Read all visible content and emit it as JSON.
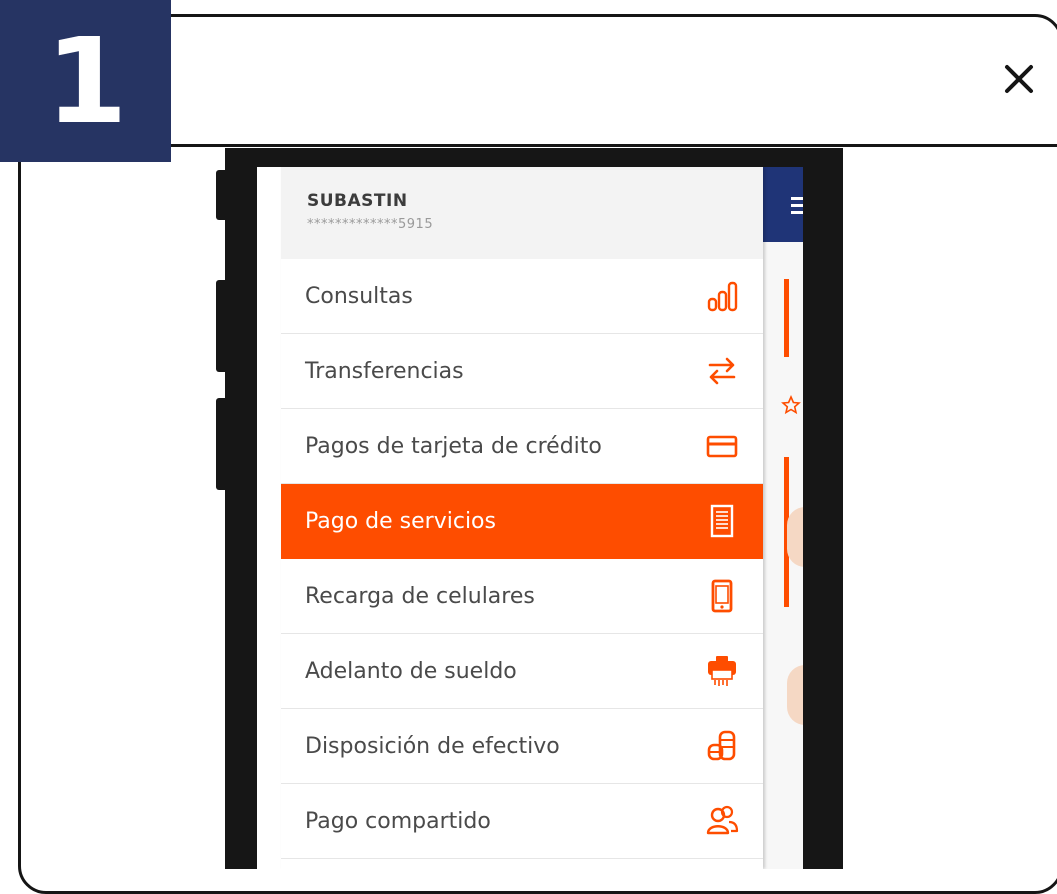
{
  "step": {
    "number": "1"
  },
  "colors": {
    "badge": "#263463",
    "accent": "#fe4d00",
    "app_nav": "#1f3477",
    "frame": "#151515"
  },
  "close_icon": "close-icon",
  "phone": {
    "user": {
      "name": "SUBASTIN",
      "account": "*************5915"
    },
    "menu_items": [
      {
        "label": "Consultas",
        "icon": "bar-chart-icon",
        "active": false
      },
      {
        "label": "Transferencias",
        "icon": "transfer-arrows-icon",
        "active": false
      },
      {
        "label": "Pagos de tarjeta de crédito",
        "icon": "credit-card-icon",
        "active": false
      },
      {
        "label": "Pago de servicios",
        "icon": "receipt-icon",
        "active": true
      },
      {
        "label": "Recarga de celulares",
        "icon": "mobile-phone-icon",
        "active": false
      },
      {
        "label": "Adelanto de sueldo",
        "icon": "cash-machine-icon",
        "active": false
      },
      {
        "label": "Disposición de efectivo",
        "icon": "coins-stack-icon",
        "active": false
      },
      {
        "label": "Pago compartido",
        "icon": "users-icon",
        "active": false
      }
    ]
  }
}
